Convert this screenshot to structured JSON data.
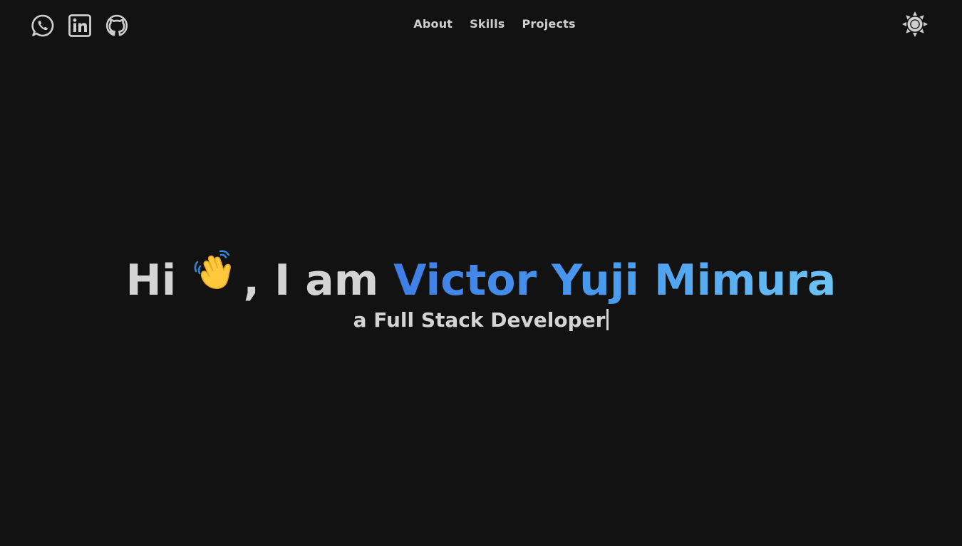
{
  "header": {
    "socials": [
      {
        "icon": "whatsapp-icon"
      },
      {
        "icon": "linkedin-icon"
      },
      {
        "icon": "github-icon"
      }
    ],
    "nav": {
      "about": "About",
      "skills": "Skills",
      "projects": "Projects"
    },
    "theme_toggle_icon": "sun-icon"
  },
  "hero": {
    "greeting_start": "Hi",
    "wave_icon": "waving-hand-icon",
    "greeting_middle": ", I am",
    "name": "Victor Yuji Mimura",
    "subtitle": "a Full Stack Developer"
  },
  "colors": {
    "background": "#121212",
    "text": "#d4d4d4",
    "name_gradient_start": "#3f7de6",
    "name_gradient_end": "#6cc3f5"
  }
}
